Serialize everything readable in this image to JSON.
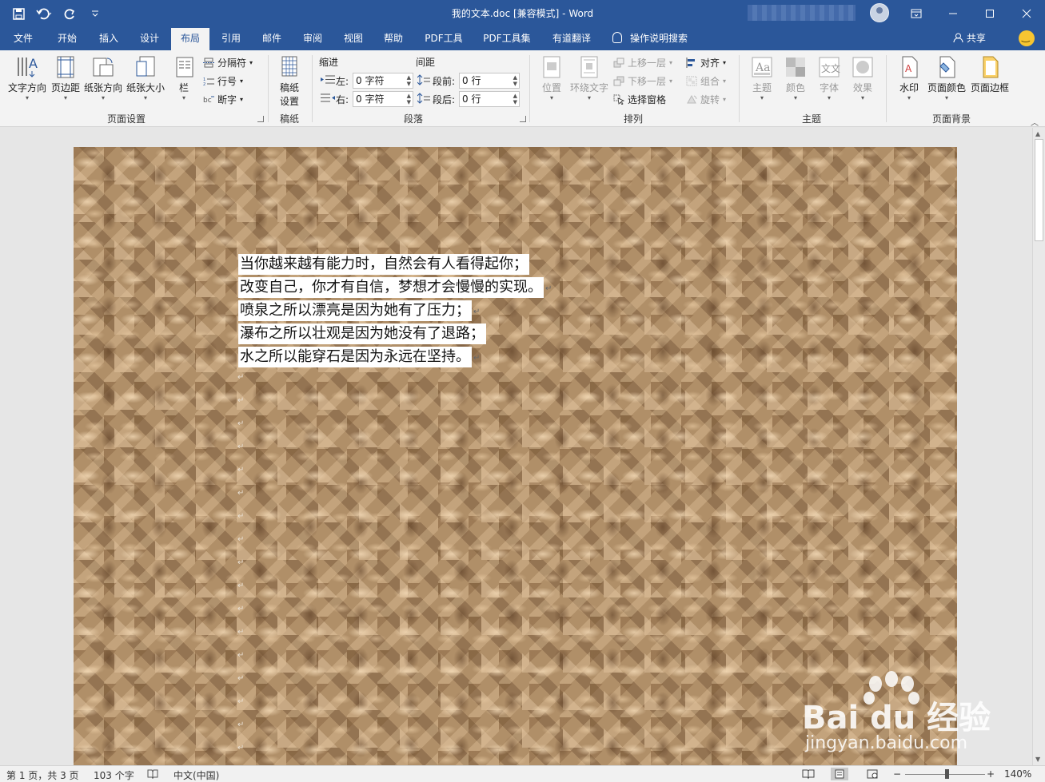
{
  "window": {
    "title": "我的文本.doc [兼容模式]  -  Word",
    "controls": [
      "ribbon-display-icon",
      "minimize-icon",
      "maximize-icon",
      "close-icon"
    ]
  },
  "qat": {
    "save": "save-icon",
    "undo": "undo-icon",
    "redo": "redo-icon",
    "customize": "customize-icon"
  },
  "tabs": [
    {
      "label": "文件"
    },
    {
      "label": "开始"
    },
    {
      "label": "插入"
    },
    {
      "label": "设计"
    },
    {
      "label": "布局",
      "active": true
    },
    {
      "label": "引用"
    },
    {
      "label": "邮件"
    },
    {
      "label": "审阅"
    },
    {
      "label": "视图"
    },
    {
      "label": "帮助"
    },
    {
      "label": "PDF工具"
    },
    {
      "label": "PDF工具集"
    },
    {
      "label": "有道翻译"
    }
  ],
  "tell_me": "操作说明搜索",
  "share": "共享",
  "ribbon": {
    "page_setup": {
      "label": "页面设置",
      "text_direction": "文字方向",
      "margins": "页边距",
      "orientation": "纸张方向",
      "size": "纸张大小",
      "columns": "栏",
      "breaks": "分隔符",
      "line_numbers": "行号",
      "hyphenation": "断字"
    },
    "manuscript": {
      "label": "稿纸",
      "setup_line1": "稿纸",
      "setup_line2": "设置"
    },
    "paragraph": {
      "label": "段落",
      "indent_title": "缩进",
      "spacing_title": "间距",
      "left_label": "左:",
      "right_label": "右:",
      "before_label": "段前:",
      "after_label": "段后:",
      "left_value": "0 字符",
      "right_value": "0 字符",
      "before_value": "0 行",
      "after_value": "0 行"
    },
    "arrange": {
      "label": "排列",
      "position": "位置",
      "wrap_text": "环绕文字",
      "bring_forward": "上移一层",
      "send_backward": "下移一层",
      "selection_pane": "选择窗格",
      "align": "对齐",
      "group": "组合",
      "rotate": "旋转"
    },
    "themes": {
      "label": "主题",
      "themes": "主题",
      "colors": "颜色",
      "fonts": "字体",
      "effects": "效果"
    },
    "page_background": {
      "label": "页面背景",
      "watermark": "水印",
      "page_color": "页面颜色",
      "page_borders": "页面边框"
    }
  },
  "document": {
    "lines": [
      "当你越来越有能力时，自然会有人看得起你；",
      "改变自己，你才有自信，梦想才会慢慢的实现。",
      "喷泉之所以漂亮是因为她有了压力；",
      "瀑布之所以壮观是因为她没有了退路；",
      "水之所以能穿石是因为永远在坚持。"
    ],
    "background": "crumpled-paper-texture"
  },
  "status": {
    "page": "第 1 页，共 3 页",
    "words": "103 个字",
    "language": "中文(中国)",
    "zoom": "140%",
    "zoom_minus": "−",
    "zoom_plus": "+",
    "zoom_fraction": 0.52
  },
  "watermark": {
    "brand": "Bai du 经验",
    "url": "jingyan.baidu.com"
  },
  "colors": {
    "accent": "#2b579a",
    "ribbon": "#f3f3f3",
    "paper": "#b08f68"
  }
}
